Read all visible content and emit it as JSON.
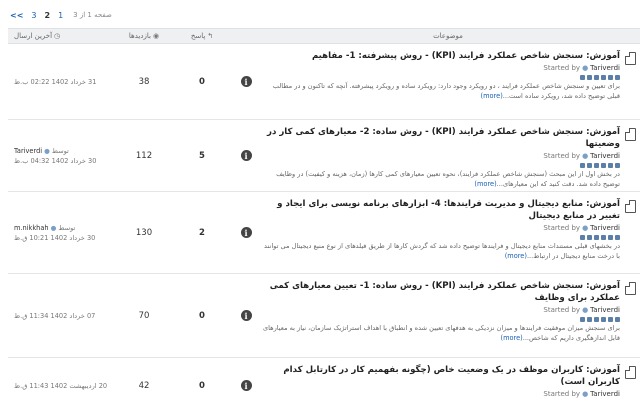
{
  "pagination": {
    "label": "صفحه 1 از 3",
    "pages": [
      "1",
      "2",
      "3"
    ],
    "current": "2",
    "next_label": ">>"
  },
  "header": {
    "topics": "موضوعات",
    "replies": "پاسخ",
    "views": "بازدیدها",
    "last_post": "آخرین ارسال"
  },
  "topics": [
    {
      "title": "آموزش: سنجش شاخص عملکرد فرایند (KPI) - روش پیشرفته: 1- مفاهیم",
      "started_by": "Started by",
      "author": "Tariverdi",
      "excerpt": "برای تعیین و سنجش شاخص عملکرد فرایند ، دو رویکرد وجود دارد: رویکرد ساده و رویکرد پیشرفته. آنچه که تاکنون و در مطالب قبلی توضیح داده شد، رویکرد ساده است...",
      "more": "(more)",
      "replies": "0",
      "views": "38",
      "last_by_label": "",
      "last_author": "",
      "last_date": "31 خرداد 1402 02:22 ب.ظ"
    },
    {
      "title": "آموزش: سنجش شاخص عملکرد فرایند (KPI) - روش ساده: 2- معیارهای کمی کار در وضعیتها",
      "started_by": "Started by",
      "author": "Tariverdi",
      "excerpt": "در بخش اول از این مبحث (سنجش شاخص عملکرد فرایند)، نحوه تعیین معیارهای کمی کارها (زمان، هزینه و کیفیت) در وظایف توضیح داده شد. دقت کنید که این معیارهای...",
      "more": "(more)",
      "replies": "5",
      "views": "112",
      "last_by_label": "توسط",
      "last_author": "Tariverdi",
      "last_date": "30 خرداد 1402 04:32 ب.ظ"
    },
    {
      "title": "آموزش: منابع دیجیتال و مدیریت فرایندها: 4- ابزارهای برنامه نویسی برای ایجاد و تغییر در منابع دیجیتال",
      "started_by": "Started by",
      "author": "Tariverdi",
      "excerpt": "در بخشهای قبلی مستندات منابع دیجیتال و فرایندها توضیح داده شد که گردش کارها از طریق فیلدهای از نوع منبع دیجیتال می توانند با درخت منابع دیجیتال در ارتباط...",
      "more": "(more)",
      "replies": "2",
      "views": "130",
      "last_by_label": "توسط",
      "last_author": "m.nikkhah",
      "last_date": "30 خرداد 1402 10:21 ق.ظ"
    },
    {
      "title": "آموزش: سنجش شاخص عملکرد فرایند (KPI) - روش ساده: 1- تعیین معیارهای کمی عملکرد برای وظایف",
      "started_by": "Started by",
      "author": "Tariverdi",
      "excerpt": "برای سنجش میزان موفقیت فرایندها و میزان نزدیکی به هدفهای تعیین شده و انطباق با اهداف استراتژیک سازمان، نیاز به معیارهای قابل اندازهگیری داریم که شاخص...",
      "more": "(more)",
      "replies": "0",
      "views": "70",
      "last_by_label": "",
      "last_author": "",
      "last_date": "07 خرداد 1402 11:34 ق.ظ"
    },
    {
      "title": "آموزش: کاربران موظف در یک وضعیت خاص (چگونه بفهمیم کار در کارتابل کدام کاربران است)",
      "started_by": "Started by",
      "author": "Tariverdi",
      "excerpt": "",
      "more": "",
      "replies": "0",
      "views": "42",
      "last_by_label": "",
      "last_author": "",
      "last_date": "20 اردیبهشت 1402 11:43 ق.ظ"
    }
  ]
}
